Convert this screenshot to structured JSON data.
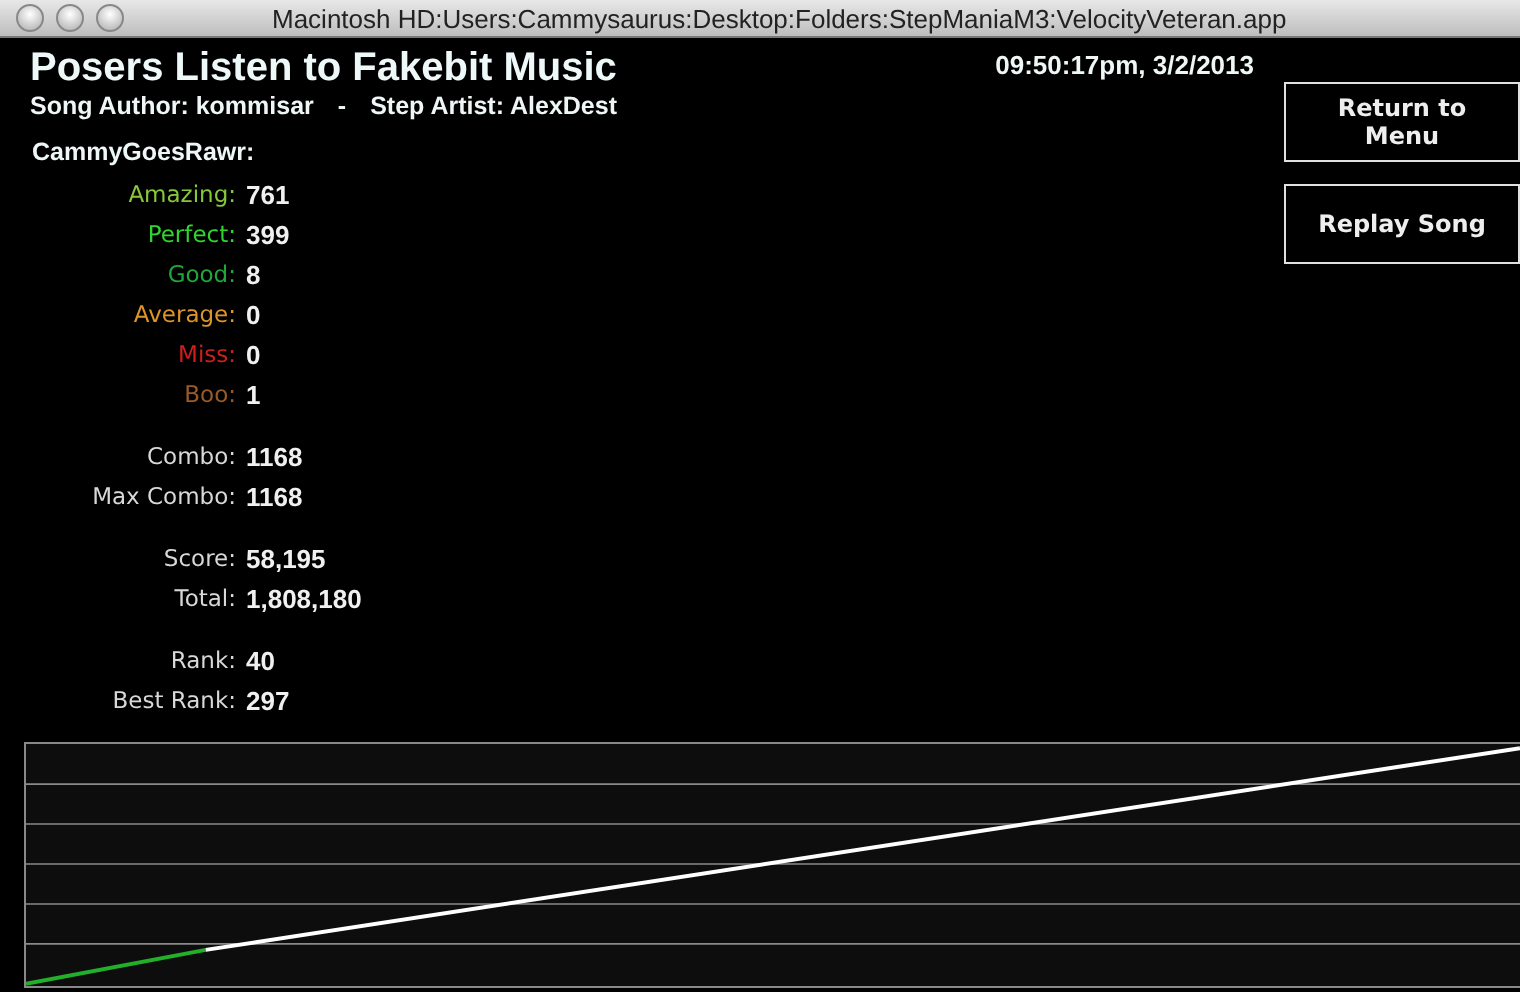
{
  "window": {
    "title": "Macintosh HD:Users:Cammysaurus:Desktop:Folders:StepManiaM3:VelocityVeteran.app"
  },
  "song": {
    "title": "Posers Listen to Fakebit Music",
    "author_label": "Song Author: kommisar",
    "separator": "-",
    "artist_label": "Step Artist: AlexDest"
  },
  "timestamp": "09:50:17pm, 3/2/2013",
  "buttons": [
    "Return to Menu",
    "Replay Song"
  ],
  "player": "CammyGoesRawr:",
  "stat_groups": [
    {
      "rows": [
        {
          "label": "Amazing:",
          "value": "761",
          "color": "#86c83a"
        },
        {
          "label": "Perfect:",
          "value": "399",
          "color": "#2fd62f"
        },
        {
          "label": "Good:",
          "value": "8",
          "color": "#1fa83a"
        },
        {
          "label": "Average:",
          "value": "0",
          "color": "#dd9428"
        },
        {
          "label": "Miss:",
          "value": "0",
          "color": "#d01e1e"
        },
        {
          "label": "Boo:",
          "value": "1",
          "color": "#9a5a28"
        }
      ]
    },
    {
      "rows": [
        {
          "label": "Combo:",
          "value": "1168"
        },
        {
          "label": "Max Combo:",
          "value": "1168"
        }
      ]
    },
    {
      "rows": [
        {
          "label": "Score:",
          "value": "58,195"
        },
        {
          "label": "Total:",
          "value": "1,808,180"
        }
      ]
    },
    {
      "rows": [
        {
          "label": "Rank:",
          "value": "40"
        },
        {
          "label": "Best Rank:",
          "value": "297"
        }
      ]
    }
  ]
}
